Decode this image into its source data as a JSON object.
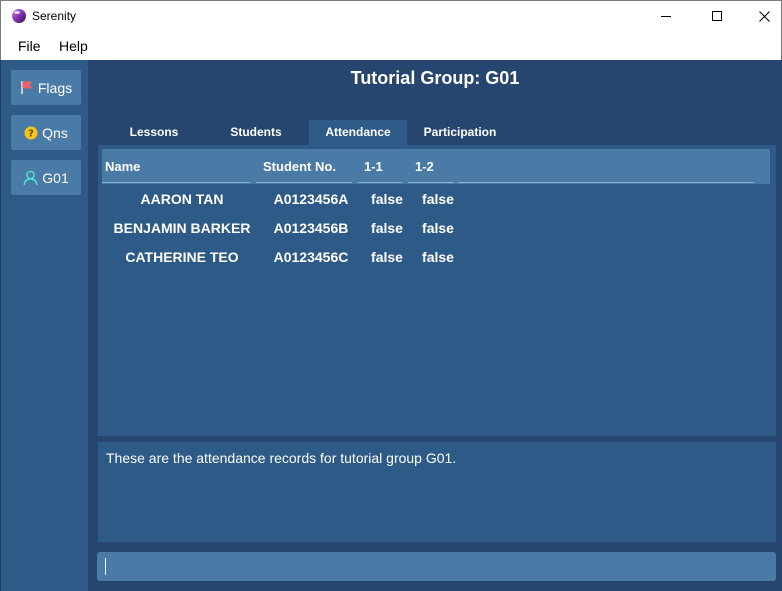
{
  "window": {
    "title": "Serenity"
  },
  "menu": {
    "file_label": "File",
    "help_label": "Help"
  },
  "sidebar": {
    "items": [
      {
        "label": "Flags",
        "icon": "flag-icon"
      },
      {
        "label": "Qns",
        "icon": "question-icon"
      },
      {
        "label": "G01",
        "icon": "user-icon"
      }
    ]
  },
  "main": {
    "title": "Tutorial Group: G01",
    "tabs": [
      {
        "label": "Lessons"
      },
      {
        "label": "Students"
      },
      {
        "label": "Attendance",
        "selected": true
      },
      {
        "label": "Participation"
      }
    ],
    "table": {
      "headers": [
        "Name",
        "Student No.",
        "1-1",
        "1-2"
      ],
      "rows": [
        {
          "name": "AARON TAN",
          "student_no": "A0123456A",
          "l1_1": "false",
          "l1_2": "false"
        },
        {
          "name": "BENJAMIN BARKER",
          "student_no": "A0123456B",
          "l1_1": "false",
          "l1_2": "false"
        },
        {
          "name": "CATHERINE TEO",
          "student_no": "A0123456C",
          "l1_1": "false",
          "l1_2": "false"
        }
      ]
    },
    "result_message": "These are the attendance records for tutorial group G01.",
    "command_input": ""
  },
  "colors": {
    "background": "#27466f",
    "sidebar": "#2e5a87",
    "panel": "#2d5a86",
    "accent": "#4a7ba6"
  }
}
